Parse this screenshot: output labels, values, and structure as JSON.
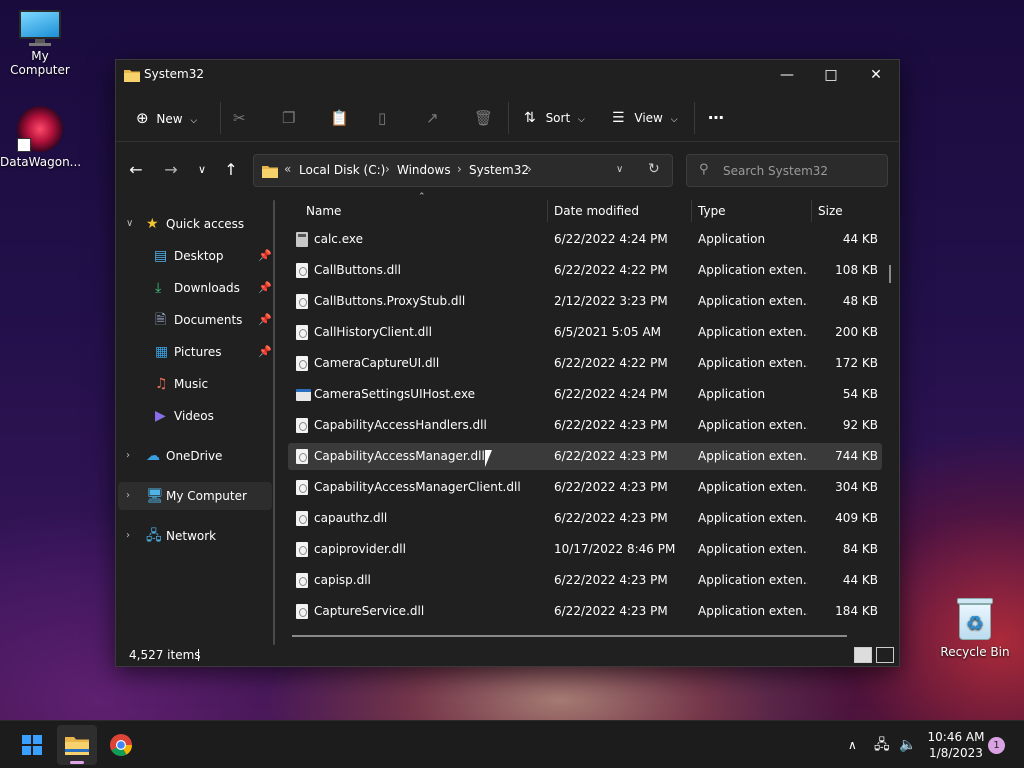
{
  "desktop": {
    "icons": [
      {
        "label": "My Computer"
      },
      {
        "label": "DataWagon..."
      },
      {
        "label": "Recycle Bin"
      }
    ]
  },
  "window": {
    "title": "System32",
    "toolbar": {
      "new_label": "New",
      "sort_label": "Sort",
      "view_label": "View"
    },
    "address": {
      "crumbs": [
        "Local Disk (C:)",
        "Windows",
        "System32"
      ],
      "overflow": "«"
    },
    "search": {
      "placeholder": "Search System32"
    },
    "sidebar": {
      "items": [
        {
          "label": "Quick access"
        },
        {
          "label": "Desktop"
        },
        {
          "label": "Downloads"
        },
        {
          "label": "Documents"
        },
        {
          "label": "Pictures"
        },
        {
          "label": "Music"
        },
        {
          "label": "Videos"
        },
        {
          "label": "OneDrive"
        },
        {
          "label": "My Computer"
        },
        {
          "label": "Network"
        }
      ]
    },
    "columns": {
      "name": "Name",
      "date": "Date modified",
      "type": "Type",
      "size": "Size"
    },
    "files": [
      {
        "name": "calc.exe",
        "date": "6/22/2022 4:24 PM",
        "type": "Application",
        "size": "44 KB",
        "icon": "calc"
      },
      {
        "name": "CallButtons.dll",
        "date": "6/22/2022 4:22 PM",
        "type": "Application exten...",
        "size": "108 KB",
        "icon": "dll"
      },
      {
        "name": "CallButtons.ProxyStub.dll",
        "date": "2/12/2022 3:23 PM",
        "type": "Application exten...",
        "size": "48 KB",
        "icon": "dll"
      },
      {
        "name": "CallHistoryClient.dll",
        "date": "6/5/2021 5:05 AM",
        "type": "Application exten...",
        "size": "200 KB",
        "icon": "dll"
      },
      {
        "name": "CameraCaptureUI.dll",
        "date": "6/22/2022 4:22 PM",
        "type": "Application exten...",
        "size": "172 KB",
        "icon": "dll"
      },
      {
        "name": "CameraSettingsUIHost.exe",
        "date": "6/22/2022 4:24 PM",
        "type": "Application",
        "size": "54 KB",
        "icon": "app"
      },
      {
        "name": "CapabilityAccessHandlers.dll",
        "date": "6/22/2022 4:23 PM",
        "type": "Application exten...",
        "size": "92 KB",
        "icon": "dll"
      },
      {
        "name": "CapabilityAccessManager.dll",
        "date": "6/22/2022 4:23 PM",
        "type": "Application exten...",
        "size": "744 KB",
        "icon": "dll"
      },
      {
        "name": "CapabilityAccessManagerClient.dll",
        "date": "6/22/2022 4:23 PM",
        "type": "Application exten...",
        "size": "304 KB",
        "icon": "dll"
      },
      {
        "name": "capauthz.dll",
        "date": "6/22/2022 4:23 PM",
        "type": "Application exten...",
        "size": "409 KB",
        "icon": "dll"
      },
      {
        "name": "capiprovider.dll",
        "date": "10/17/2022 8:46 PM",
        "type": "Application exten...",
        "size": "84 KB",
        "icon": "dll"
      },
      {
        "name": "capisp.dll",
        "date": "6/22/2022 4:23 PM",
        "type": "Application exten...",
        "size": "44 KB",
        "icon": "dll"
      },
      {
        "name": "CaptureService.dll",
        "date": "6/22/2022 4:23 PM",
        "type": "Application exten...",
        "size": "184 KB",
        "icon": "dll"
      }
    ],
    "status": {
      "item_count": "4,527 items"
    }
  },
  "taskbar": {
    "time": "10:46 AM",
    "date": "1/8/2023",
    "notification_count": "1"
  },
  "colors": {
    "accent": "#3aa0ff",
    "window_bg": "#202020",
    "hover_row": "#3a3a3a"
  }
}
